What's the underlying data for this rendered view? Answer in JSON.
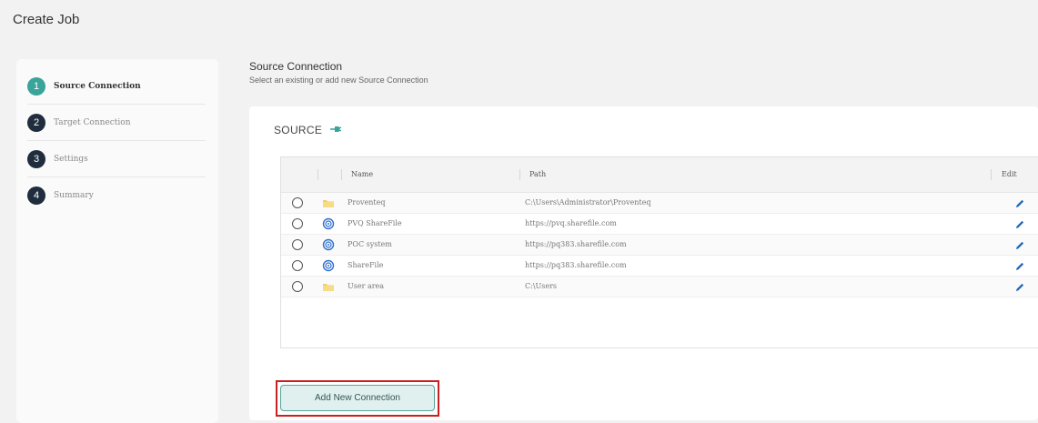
{
  "page": {
    "title": "Create Job"
  },
  "stepper": {
    "steps": [
      {
        "number": "1",
        "label": "Source Connection",
        "active": true
      },
      {
        "number": "2",
        "label": "Target Connection",
        "active": false
      },
      {
        "number": "3",
        "label": "Settings",
        "active": false
      },
      {
        "number": "4",
        "label": "Summary",
        "active": false
      }
    ]
  },
  "section": {
    "title": "Source Connection",
    "subtitle": "Select an existing or add new Source Connection"
  },
  "card": {
    "source_label": "SOURCE",
    "grid": {
      "columns": {
        "name": "Name",
        "path": "Path",
        "edit": "Edit"
      },
      "rows": [
        {
          "name": "Proventeq",
          "path": "C:\\Users\\Administrator\\Proventeq",
          "icon": "folder-icon"
        },
        {
          "name": "PVQ ShareFile",
          "path": "https://pvq.sharefile.com",
          "icon": "sharefile-icon"
        },
        {
          "name": "POC system",
          "path": "https://pq383.sharefile.com",
          "icon": "sharefile-icon"
        },
        {
          "name": "ShareFile",
          "path": "https://pq383.sharefile.com",
          "icon": "sharefile-icon"
        },
        {
          "name": "User area",
          "path": "C:\\Users",
          "icon": "folder-icon"
        }
      ]
    },
    "add_button_label": "Add New Connection"
  },
  "colors": {
    "accent": "#3aa39a",
    "step_dark": "#1f2d3d",
    "edit_blue": "#1f63b8",
    "highlight_red": "#cc1f1f"
  }
}
